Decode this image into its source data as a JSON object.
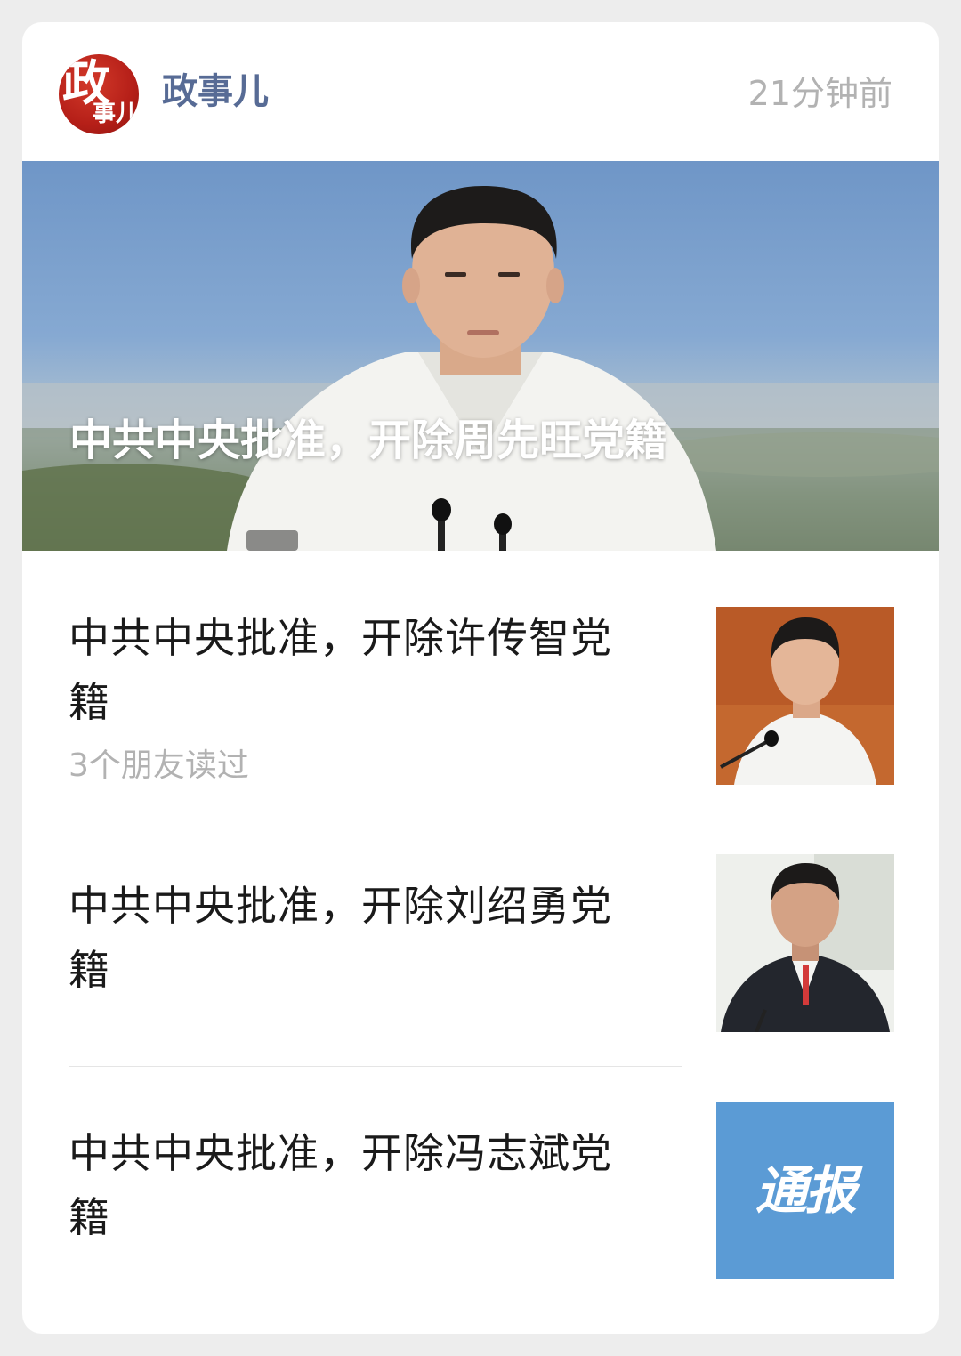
{
  "header": {
    "logo_text_big": "政",
    "logo_text_small": "事儿",
    "account_name": "政事儿",
    "timestamp": "21分钟前"
  },
  "hero": {
    "title": "中共中央批准，开除周先旺党籍"
  },
  "articles": [
    {
      "title_line1": "中共中央批准，开除许传智党",
      "title_line2": "籍",
      "meta": "3个朋友读过"
    },
    {
      "title_line1": "中共中央批准，开除刘绍勇党",
      "title_line2": "籍"
    },
    {
      "title_line1": "中共中央批准，开除冯志斌党",
      "title_line2": "籍",
      "thumb_text": "通报"
    }
  ],
  "colors": {
    "account_name": "#576b95",
    "muted": "#b2b2b2",
    "logo_red": "#b51f18",
    "notice_blue": "#5b9bd5"
  }
}
